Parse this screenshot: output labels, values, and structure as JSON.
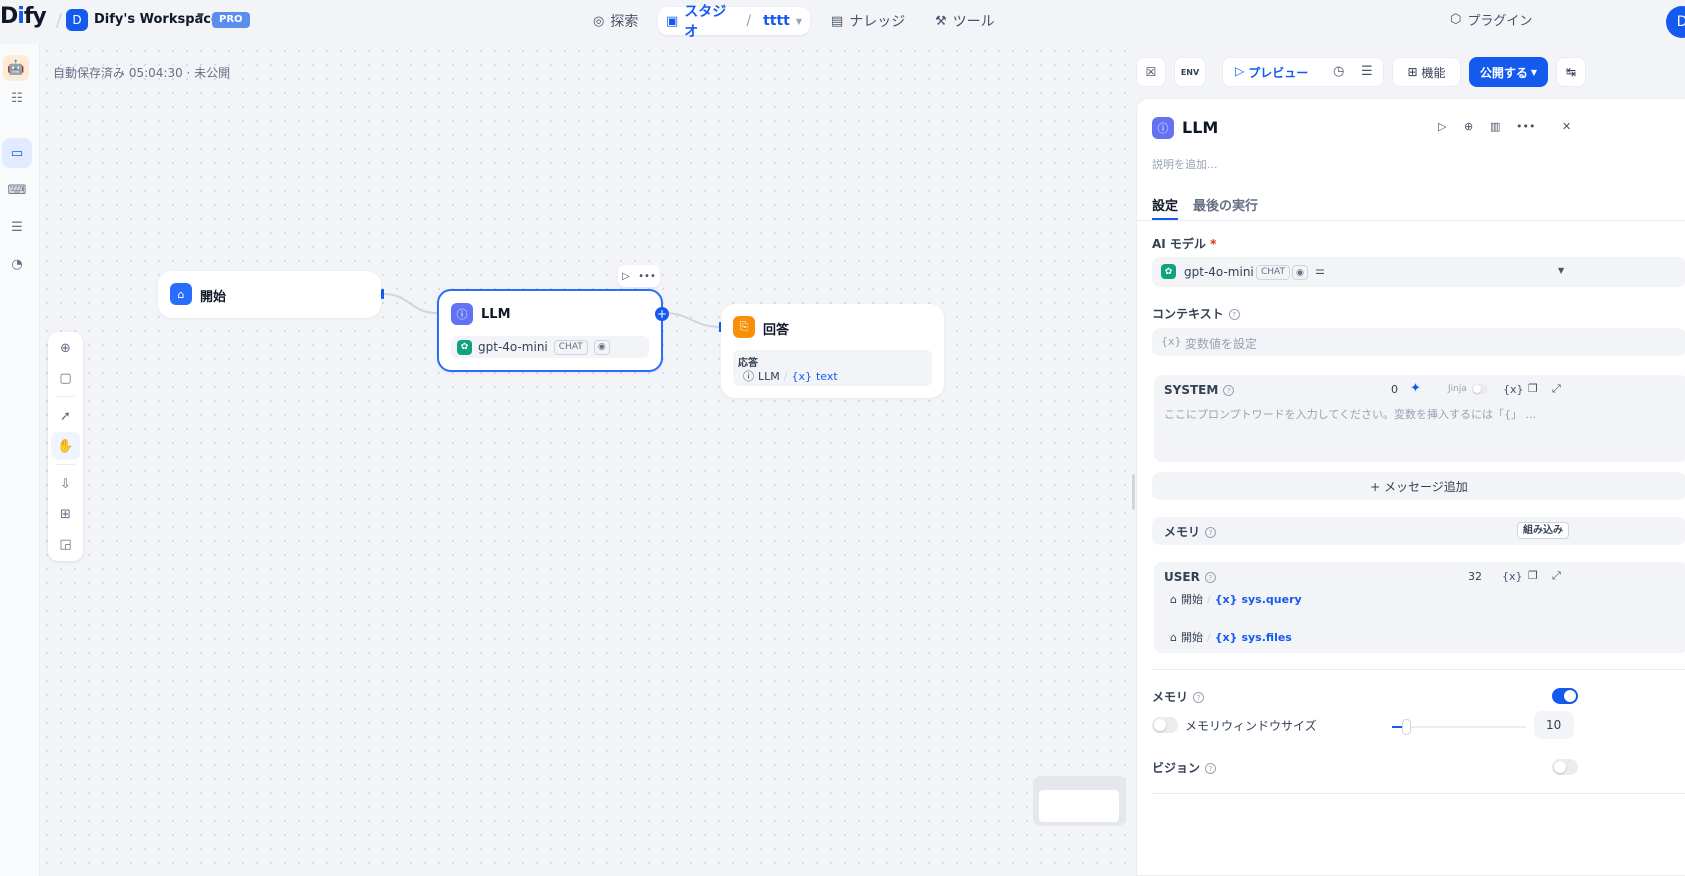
{
  "header": {
    "logo": "Dify",
    "workspace_initial": "D",
    "workspace_name": "Dify's Workspace",
    "plan_badge": "PRO",
    "nav": {
      "explore": "探索",
      "studio": "スタジオ",
      "app_name": "tttt",
      "knowledge": "ナレッジ",
      "tools": "ツール"
    },
    "plugins": "プラグイン",
    "user_initial": "D"
  },
  "status": {
    "autosave": "自動保存済み 05:04:30 · 未公開"
  },
  "canvas": {
    "start_node": {
      "title": "開始"
    },
    "llm_node": {
      "title": "LLM",
      "model": "gpt-4o-mini",
      "mode_tag": "CHAT"
    },
    "answer_node": {
      "title": "回答",
      "label": "応答",
      "ref_node": "LLM",
      "ref_var": "text"
    }
  },
  "toolbar": {
    "preview": "プレビュー",
    "features": "機能",
    "publish": "公開する",
    "env": "ENV"
  },
  "panel": {
    "title": "LLM",
    "description_placeholder": "説明を追加...",
    "tabs": {
      "settings": "設定",
      "last_run": "最後の実行"
    },
    "ai_model_label": "AI モデル",
    "model": "gpt-4o-mini",
    "model_tag": "CHAT",
    "context_label": "コンテキスト",
    "context_placeholder": "変数値を設定",
    "system": {
      "role": "SYSTEM",
      "count": "0",
      "jinja": "Jinja",
      "placeholder": "ここにプロンプトワードを入力してください。変数を挿入するには「{」 ..."
    },
    "add_message": "メッセージ追加",
    "memory_row": {
      "label": "メモリ",
      "badge": "組み込み"
    },
    "user": {
      "role": "USER",
      "count": "32",
      "refs": [
        {
          "node": "開始",
          "var": "sys.query"
        },
        {
          "node": "開始",
          "var": "sys.files"
        }
      ]
    },
    "memory_label": "メモリ",
    "memory_window_label": "メモリウィンドウサイズ",
    "memory_window_value": "10",
    "vision_label": "ビジョン"
  }
}
